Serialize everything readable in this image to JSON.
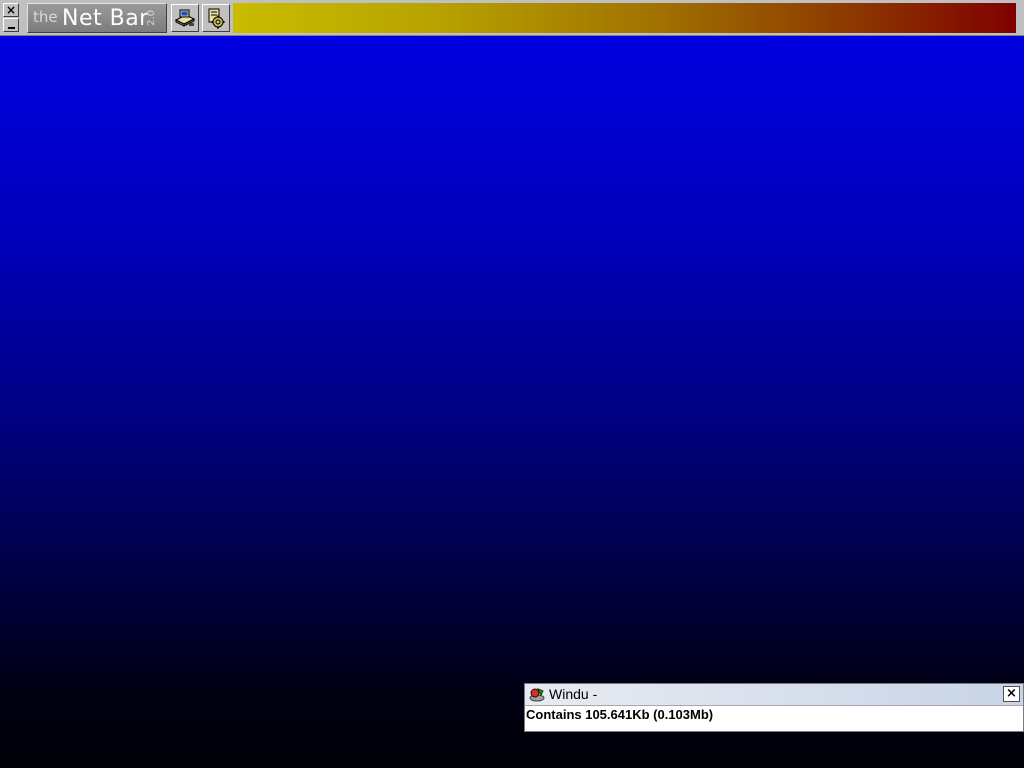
{
  "desktop": {
    "top_color": "#0000e8",
    "bottom_color": "#000008"
  },
  "netbar": {
    "close_label": "×",
    "logo": {
      "the": "the",
      "name": "Net Bar",
      "version": "2.0"
    },
    "tools": [
      {
        "icon": "network-computer-icon"
      },
      {
        "icon": "settings-gear-icon"
      }
    ],
    "gradient_colors": [
      "#c8bc00",
      "#800000"
    ]
  },
  "windu": {
    "title": "Windu -",
    "close_label": "×",
    "icon": "windu-app-icon",
    "message": "Contains 105.641Kb (0.103Mb)"
  }
}
